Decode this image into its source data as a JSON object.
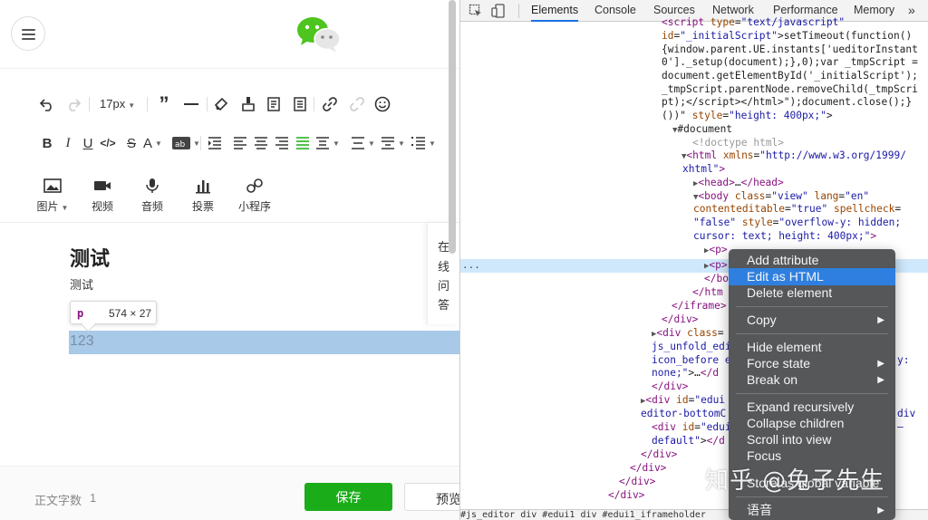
{
  "editor": {
    "toolbar": {
      "font_size": "17px",
      "insert_items": [
        {
          "label": "图片",
          "has_caret": true
        },
        {
          "label": "视频"
        },
        {
          "label": "音频"
        },
        {
          "label": "投票"
        },
        {
          "label": "小程序"
        }
      ]
    },
    "content": {
      "title": "测试",
      "para1": "测试",
      "para2": "123",
      "tooltip_tag": "p",
      "tooltip_dims": "574 × 27",
      "side_panel_chars": [
        "在",
        "线",
        "问",
        "答"
      ]
    },
    "footer": {
      "word_count_label": "正文字数",
      "word_count_value": "1",
      "save_label": "保存",
      "preview_label": "预览"
    }
  },
  "devtools": {
    "tabs": [
      "Elements",
      "Console",
      "Sources",
      "Network",
      "Performance",
      "Memory"
    ],
    "active_tab": "Elements",
    "more": "»",
    "breadcrumb": "#js_editor   div   #edui1   div   #edui1_iframeholder",
    "context_menu": {
      "items": [
        {
          "label": "Add attribute",
          "submenu": false,
          "group": 1
        },
        {
          "label": "Edit as HTML",
          "submenu": false,
          "group": 1,
          "highlighted": true
        },
        {
          "label": "Delete element",
          "submenu": false,
          "group": 1
        },
        {
          "label": "Copy",
          "submenu": true,
          "group": 2
        },
        {
          "label": "Hide element",
          "submenu": false,
          "group": 3
        },
        {
          "label": "Force state",
          "submenu": true,
          "group": 3
        },
        {
          "label": "Break on",
          "submenu": true,
          "group": 3
        },
        {
          "label": "Expand recursively",
          "submenu": false,
          "group": 4
        },
        {
          "label": "Collapse children",
          "submenu": false,
          "group": 4
        },
        {
          "label": "Scroll into view",
          "submenu": false,
          "group": 4
        },
        {
          "label": "Focus",
          "submenu": false,
          "group": 4
        },
        {
          "label": "Store as global variable",
          "submenu": false,
          "group": 4
        },
        {
          "label": "语音",
          "submenu": true,
          "group": 5
        }
      ]
    },
    "watermark": "知乎 @兔子先生"
  },
  "colors": {
    "save_green": "#1aad19",
    "selection_blue": "#9fc3e6",
    "menu_highlight": "#2f7fe0",
    "tag_purple": "#881280",
    "attr_brown": "#994500",
    "value_blue": "#1a1aa6"
  }
}
